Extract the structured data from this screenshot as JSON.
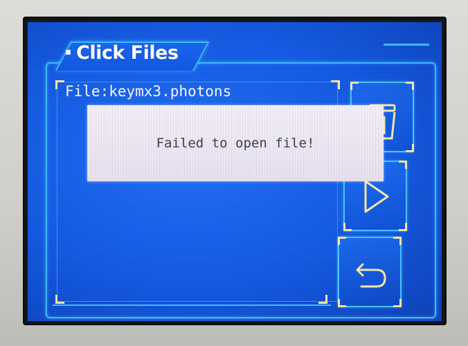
{
  "header": {
    "title": "Click Files"
  },
  "file": {
    "label": "File:keymx3.photons"
  },
  "dialog": {
    "message": "Failed to open file!"
  },
  "buttons": [
    {
      "icon": "trash-icon"
    },
    {
      "icon": "play-icon"
    },
    {
      "icon": "back-arrow-icon"
    }
  ],
  "colors": {
    "screen_blue": "#1257df",
    "frame_cyan": "#3fb8ff",
    "icon_yellow": "#f4e6a4",
    "dialog_bg": "#efeaf3",
    "dialog_text": "#3b3f55"
  }
}
